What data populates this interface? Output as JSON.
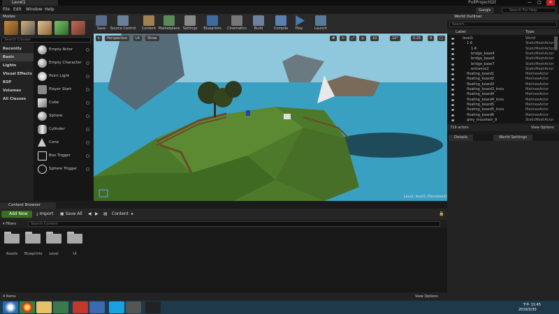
{
  "window": {
    "tab_title": "Level1",
    "project_name": "PullProjectGit",
    "minimize": "—",
    "maximize": "□",
    "close": "✕"
  },
  "menu": {
    "items": [
      "File",
      "Edit",
      "Window",
      "Help"
    ]
  },
  "help_search": {
    "engine_badge": "Google",
    "placeholder": "Search For Help"
  },
  "modes": {
    "title": "Modes",
    "search_placeholder": "Search Classes",
    "categories": [
      "Recently Placed",
      "Basic",
      "Lights",
      "Visual Effects",
      "BSP",
      "Volumes",
      "All Classes"
    ],
    "active_category": "Basic",
    "items": [
      "Empty Actor",
      "Empty Character",
      "Point Light",
      "Player Start",
      "Cube",
      "Sphere",
      "Cylinder",
      "Cone",
      "Box Trigger",
      "Sphere Trigger"
    ]
  },
  "toolbar": {
    "buttons": [
      "Save",
      "Source Control",
      "Content",
      "Marketplace",
      "Settings",
      "Blueprints",
      "Cinematics",
      "Build",
      "Compile",
      "Play",
      "Launch"
    ]
  },
  "viewport": {
    "perspective_label": "Perspective",
    "lit_label": "Lit",
    "show_label": "Show",
    "snap_grid": "10",
    "snap_rot": "10°",
    "snap_scale": "0.25",
    "camera_speed": "4",
    "caption": "Level: level1 (Persistent)"
  },
  "outliner": {
    "title": "World Outliner",
    "search_placeholder": "Search...",
    "col_label": "Label",
    "col_type": "Type",
    "rows": [
      {
        "name": "level1",
        "type": "World",
        "indent": 0
      },
      {
        "name": "1-6",
        "type": "StaticMeshActor",
        "indent": 1
      },
      {
        "name": "1-6",
        "type": "StaticMeshActor",
        "indent": 2
      },
      {
        "name": "bridge_base4",
        "type": "StaticMeshActor",
        "indent": 2
      },
      {
        "name": "bridge_base6",
        "type": "StaticMeshActor",
        "indent": 2
      },
      {
        "name": "bridge_base7",
        "type": "StaticMeshActor",
        "indent": 2
      },
      {
        "name": "entrance2",
        "type": "StaticMeshActor",
        "indent": 2
      },
      {
        "name": "floating_board1",
        "type": "MatineeActor",
        "indent": 1
      },
      {
        "name": "floating_board2",
        "type": "MatineeActor",
        "indent": 1
      },
      {
        "name": "floating_board3",
        "type": "MatineeActor",
        "indent": 1
      },
      {
        "name": "floating_board3_invis",
        "type": "MatineeActor",
        "indent": 1
      },
      {
        "name": "floating_board4",
        "type": "MatineeActor",
        "indent": 1
      },
      {
        "name": "floating_board4_invis",
        "type": "MatineeActor",
        "indent": 1
      },
      {
        "name": "floating_board5",
        "type": "MatineeActor",
        "indent": 1
      },
      {
        "name": "floating_board5_invis",
        "type": "MatineeActor",
        "indent": 1
      },
      {
        "name": "floating_board6",
        "type": "MatineeActor",
        "indent": 1
      },
      {
        "name": "grey_mountain_9",
        "type": "StaticMeshActor",
        "indent": 1
      }
    ],
    "actor_count": "719 actors",
    "view_options": "View Options"
  },
  "details": {
    "tab_details": "Details",
    "tab_world_settings": "World Settings"
  },
  "content_browser": {
    "tab_title": "Content Browser",
    "add_new": "Add New",
    "import": "Import",
    "save_all": "Save All",
    "path": "Content",
    "filters": "Filters",
    "search_placeholder": "Search Content",
    "folders": [
      "Assets",
      "Blueprints",
      "Level",
      "UI"
    ],
    "item_count": "4 items",
    "view_options": "View Options"
  },
  "taskbar": {
    "time": "下午 11:45",
    "date": "2016/3/30"
  },
  "colors": {
    "sky": "#3fa2c5",
    "grass": "#4d7a2a",
    "add_new_green": "#3a6e1f",
    "panel_bg": "#232323"
  }
}
